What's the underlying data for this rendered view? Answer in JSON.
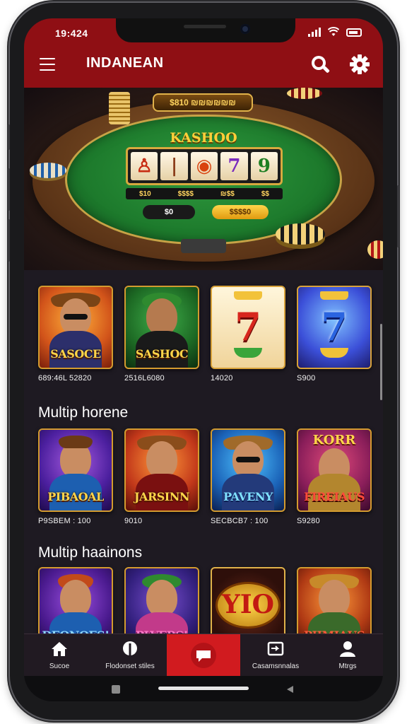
{
  "status": {
    "time": "19:424"
  },
  "header": {
    "title": "INDANEAN"
  },
  "hero": {
    "badge": "$810 ₪₪₪₪₪₪",
    "game_title": "KASHOO",
    "reels": [
      "♙",
      "|",
      "◉",
      "7",
      "9"
    ],
    "bet_strip": [
      "$10",
      "$$$$",
      "₪$$",
      "$$"
    ],
    "pill_left": "$0",
    "pill_right": "$$$$0"
  },
  "row1": {
    "tiles": [
      {
        "label": "SASOCE"
      },
      {
        "label": "SASHOC"
      },
      {
        "label": "7"
      },
      {
        "label": "7"
      }
    ],
    "captions": [
      "689:46L 52820",
      "2516L6080",
      "14020",
      "S900"
    ]
  },
  "section2": {
    "title": "Multip horene"
  },
  "row2": {
    "tiles": [
      {
        "label": "PIBAOAL"
      },
      {
        "label": "JARSINN"
      },
      {
        "label": "PAVENY"
      },
      {
        "label": "FIREIAUS",
        "top": "KORR"
      }
    ],
    "captions": [
      "P9SBEM : 100",
      "9010",
      "SECBCB7 : 100",
      "S9280"
    ]
  },
  "section3": {
    "title": "Multip haainons"
  },
  "row3": {
    "tiles": [
      {
        "label": "DEONOES!"
      },
      {
        "label": "PLVERS!"
      },
      {
        "label": "YIO"
      },
      {
        "label": "PIIMIAUS"
      }
    ]
  },
  "nav": {
    "items": [
      {
        "label": "Sucoe"
      },
      {
        "label": "Flodonset stiles"
      },
      {
        "label": ""
      },
      {
        "label": "Casamsnnalas"
      },
      {
        "label": "Mtrgs"
      }
    ]
  },
  "colors": {
    "header": "#8f0f14",
    "accent": "#d11b1f",
    "gold": "#d39b2f",
    "background": "#1e1a22"
  }
}
